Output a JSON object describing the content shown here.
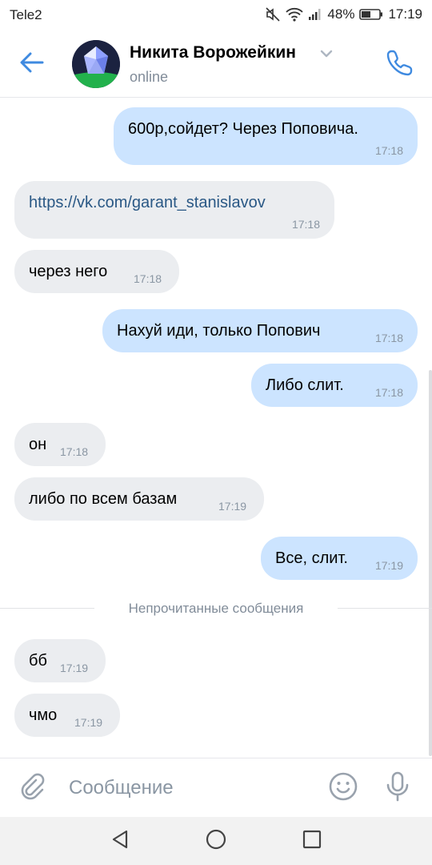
{
  "status_bar": {
    "carrier": "Tele2",
    "battery": "48%",
    "time": "17:19"
  },
  "header": {
    "contact_name": "Никита Ворожейкин",
    "status": "online",
    "icons": [
      "back-arrow-icon",
      "chevron-down-icon",
      "phone-icon"
    ]
  },
  "messages": [
    {
      "direction": "out",
      "text": "600р,сойдет? Через Поповича.",
      "time": "17:18"
    },
    {
      "direction": "in",
      "text": "https://vk.com/garant_stanislavov",
      "time": "17:18",
      "is_link": true
    },
    {
      "direction": "in",
      "text": "через него",
      "time": "17:18"
    },
    {
      "direction": "out",
      "text": "Нахуй иди, только Попович",
      "time": "17:18"
    },
    {
      "direction": "out",
      "text": "Либо слит.",
      "time": "17:18"
    },
    {
      "direction": "in",
      "text": "он",
      "time": "17:18"
    },
    {
      "direction": "in",
      "text": "либо по всем базам",
      "time": "17:19"
    },
    {
      "direction": "out",
      "text": "Все, слит.",
      "time": "17:19"
    },
    {
      "direction": "in",
      "text": "бб",
      "time": "17:19"
    },
    {
      "direction": "in",
      "text": "чмо",
      "time": "17:19"
    }
  ],
  "unread_divider": "Непрочитанные сообщения",
  "composer": {
    "placeholder": "Сообщение",
    "icons": [
      "paperclip-icon",
      "emoji-icon",
      "microphone-icon"
    ]
  },
  "colors": {
    "accent": "#3f8ae0",
    "incoming_bubble": "#ebedf0",
    "outgoing_bubble": "#cce4ff",
    "link": "#2a5885",
    "secondary_text": "#818c99"
  }
}
